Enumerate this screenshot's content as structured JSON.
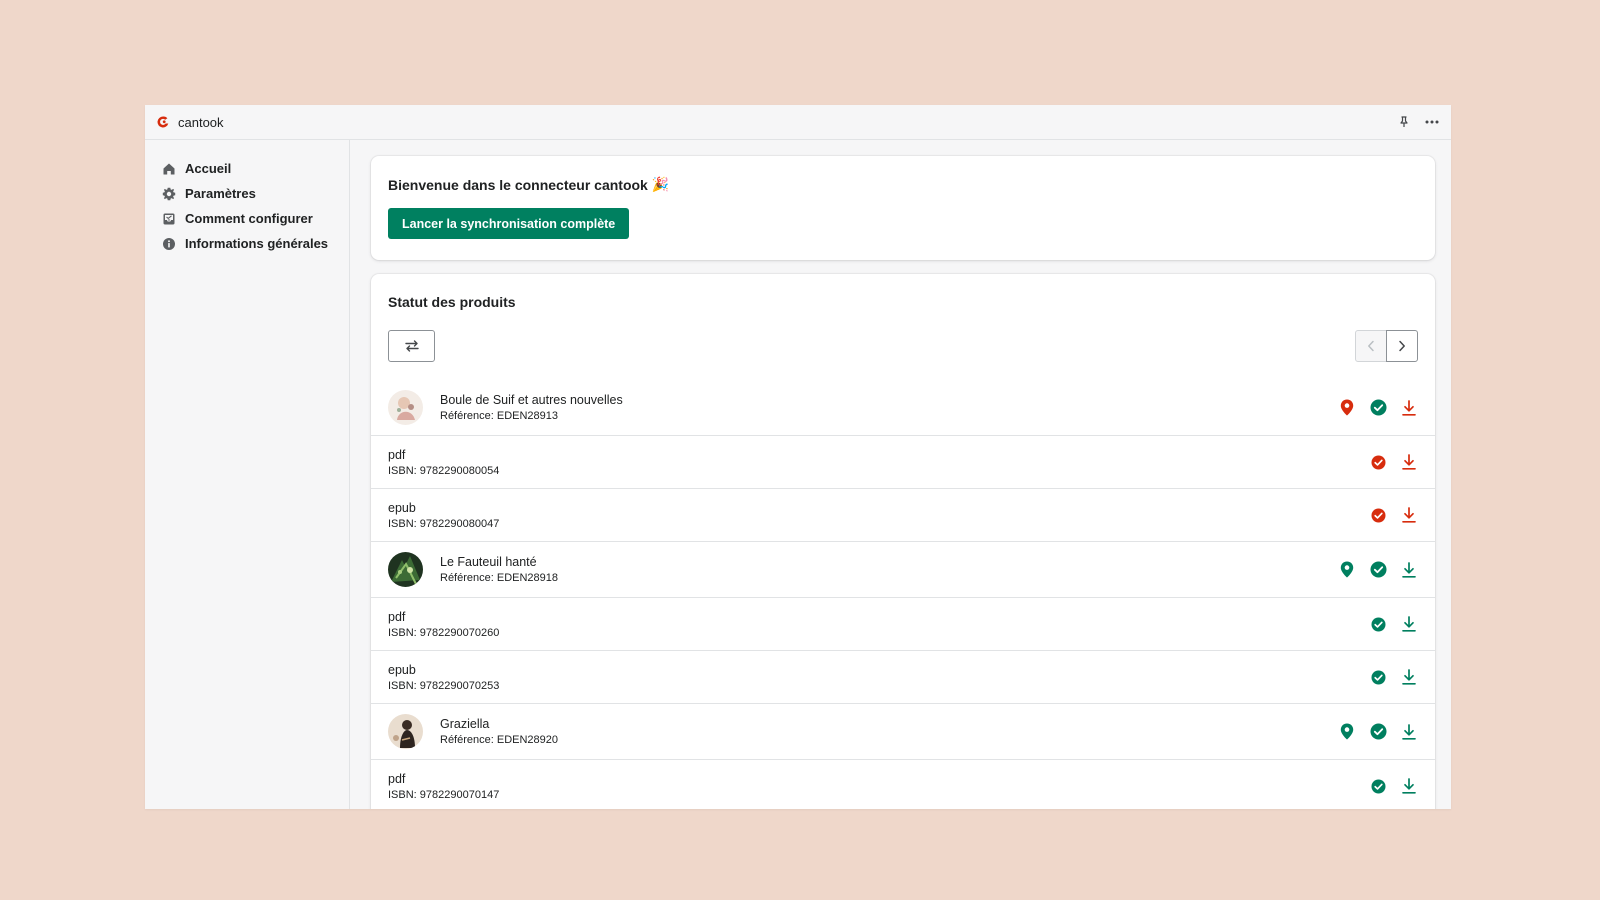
{
  "app": {
    "title": "cantook"
  },
  "sidebar": {
    "items": [
      {
        "label": "Accueil",
        "icon": "home-icon"
      },
      {
        "label": "Paramètres",
        "icon": "gear-icon"
      },
      {
        "label": "Comment configurer",
        "icon": "inbox-icon"
      },
      {
        "label": "Informations générales",
        "icon": "info-icon"
      }
    ]
  },
  "welcome": {
    "title": "Bienvenue dans le connecteur cantook",
    "emoji": "🎉",
    "button_label": "Lancer la synchronisation complète"
  },
  "status": {
    "title": "Statut des produits",
    "rows": [
      {
        "type": "product",
        "title": "Boule de Suif et autres nouvelles",
        "sub": "Référence: EDEN28913",
        "location": "error",
        "check": "success",
        "download": "error"
      },
      {
        "type": "variant",
        "title": "pdf",
        "sub": "ISBN: 9782290080054",
        "check": "error",
        "download": "error"
      },
      {
        "type": "variant",
        "title": "epub",
        "sub": "ISBN: 9782290080047",
        "check": "error",
        "download": "error"
      },
      {
        "type": "product",
        "title": "Le Fauteuil hanté",
        "sub": "Référence: EDEN28918",
        "location": "success",
        "check": "success",
        "download": "success"
      },
      {
        "type": "variant",
        "title": "pdf",
        "sub": "ISBN: 9782290070260",
        "check": "success",
        "download": "success"
      },
      {
        "type": "variant",
        "title": "epub",
        "sub": "ISBN: 9782290070253",
        "check": "success",
        "download": "success"
      },
      {
        "type": "product",
        "title": "Graziella",
        "sub": "Référence: EDEN28920",
        "location": "success",
        "check": "success",
        "download": "success"
      },
      {
        "type": "variant",
        "title": "pdf",
        "sub": "ISBN: 9782290070147",
        "check": "success",
        "download": "success"
      }
    ]
  },
  "colors": {
    "accent": "#008060",
    "success": "#007f5f",
    "error": "#d72c0d",
    "brand": "#d72c0d",
    "background": "#efd7ca"
  }
}
